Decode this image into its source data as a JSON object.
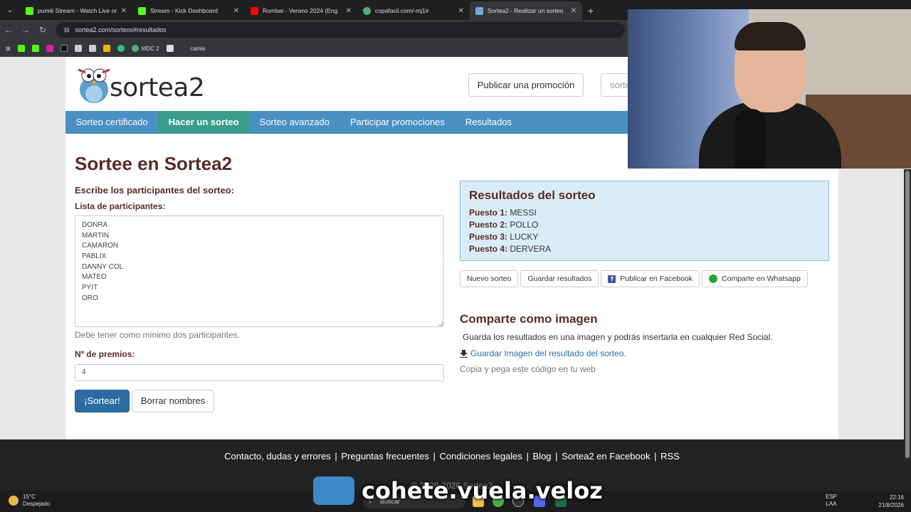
{
  "browser": {
    "tabs": [
      {
        "title": "pumiii Stream - Watch Live on K",
        "color": "#53fc18"
      },
      {
        "title": "Stream - Kick Dashboard",
        "color": "#53fc18"
      },
      {
        "title": "Rombai - Verano 2024 (Eng",
        "color": "#ff0000"
      },
      {
        "title": "copafacil.com/-mj1ir",
        "color": "#4caf7a"
      },
      {
        "title": "Sortea2 - Realizar un sorteo",
        "color": "#6fa8dc"
      }
    ],
    "url": "sortea2.com/sorteos#resultados",
    "bookmarks": [
      "MDC 2",
      "camis"
    ]
  },
  "site": {
    "logo_text": "sortea2",
    "promo_button": "Publicar una promoción",
    "search_placeholder": "sorteo",
    "nav": [
      "Sorteo certificado",
      "Hacer un sorteo",
      "Sorteo avanzado",
      "Participar promociones",
      "Resultados"
    ],
    "nav_active": "Hacer un sorteo"
  },
  "form": {
    "title": "Sortee en Sortea2",
    "subtitle": "Escribe los participantes del sorteo:",
    "list_label": "Lista de participantes:",
    "participants": [
      "DONRA",
      "MARTIN",
      "CAMARON",
      "PABLIX",
      "DANNY COL",
      "MATEO",
      "PYIT",
      "ORO"
    ],
    "hint": "Debe tener como mínimo dos participantes.",
    "prizes_label": "Nº de premios:",
    "prizes_value": "4",
    "draw_button": "¡Sortear!",
    "clear_button": "Borrar nombres"
  },
  "results": {
    "title": "Resultados del sorteo",
    "rows": [
      {
        "label": "Puesto 1:",
        "name": "MESSI"
      },
      {
        "label": "Puesto 2:",
        "name": "POLLO"
      },
      {
        "label": "Puesto 3:",
        "name": "LUCKY"
      },
      {
        "label": "Puesto 4:",
        "name": "DERVERA"
      }
    ],
    "actions": {
      "new": "Nuevo sorteo",
      "save": "Guardar resultados",
      "facebook": "Publicar en Facebook",
      "whatsapp": "Comparte en Whatsapp"
    }
  },
  "share": {
    "title": "Comparte como imagen",
    "text": "Guarda los resultados en una imagen y podrás insertarla en cualquier Red Social.",
    "link": "Guardar Imagen del resultado del sorteo.",
    "copy": "Copia y pega este código en tu web"
  },
  "footer": {
    "links": [
      "Contacto, dudas y errores",
      "Preguntas frecuentes",
      "Condiciones legales",
      "Blog",
      "Sortea2 en Facebook",
      "RSS"
    ],
    "copyright": "© 2008-2026 Sortea2"
  },
  "overlay": {
    "brand": "cohete.vuela.veloz"
  },
  "taskbar": {
    "temp": "15°C",
    "weather": "Despejado",
    "search": "Buscar",
    "lang1": "ESP",
    "lang2": "LAA",
    "time": "22:16",
    "date": "21/8/2026"
  }
}
